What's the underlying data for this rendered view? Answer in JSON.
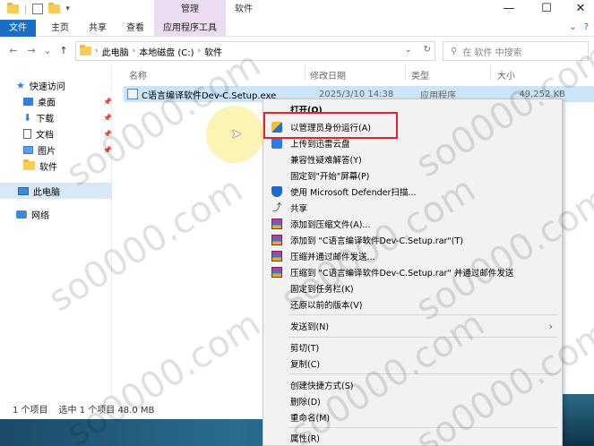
{
  "titlebar": {
    "manage_tab": "管理",
    "title": "软件",
    "minimize": "—",
    "maximize": "☐",
    "close": "✕"
  },
  "ribbon": {
    "tabs": [
      "文件",
      "主页",
      "共享",
      "查看",
      "应用程序工具"
    ],
    "collapse": "⌄",
    "help": "?"
  },
  "nav": {
    "back": "←",
    "forward": "→",
    "recent": "⌄",
    "up": "↑"
  },
  "address": {
    "crumbs": [
      "此电脑",
      "本地磁盘 (C:)",
      "软件"
    ],
    "separator": "›",
    "dropdown": "⌄",
    "refresh": "↻"
  },
  "search": {
    "placeholder": "在 软件 中搜索"
  },
  "sidebar": {
    "items": [
      {
        "label": "快速访问",
        "icon": "star-icon"
      },
      {
        "label": "桌面",
        "icon": "desktop-icon"
      },
      {
        "label": "下载",
        "icon": "download-icon"
      },
      {
        "label": "文档",
        "icon": "document-icon"
      },
      {
        "label": "图片",
        "icon": "picture-icon"
      },
      {
        "label": "软件",
        "icon": "folder-icon"
      },
      {
        "label": "此电脑",
        "icon": "computer-icon"
      },
      {
        "label": "网络",
        "icon": "network-icon"
      }
    ]
  },
  "columns": {
    "name": "名称",
    "date": "修改日期",
    "type": "类型",
    "size": "大小"
  },
  "file": {
    "name": "C语言编译软件Dev-C.Setup.exe",
    "date": "2025/3/10 14:38",
    "type": "应用程序",
    "size": "49,252 KB"
  },
  "status": {
    "count": "1 个项目",
    "selected": "选中 1 个项目  48.0 MB"
  },
  "context_menu": {
    "items": [
      {
        "label": "打开(O)",
        "icon": ""
      },
      {
        "label": "以管理员身份运行(A)",
        "icon": "uac-shield-icon"
      },
      {
        "label": "上传到迅雷云盘",
        "icon": "xunlei-icon"
      },
      {
        "label": "兼容性疑难解答(Y)",
        "icon": ""
      },
      {
        "label": "固定到\"开始\"屏幕(P)",
        "icon": ""
      },
      {
        "label": "使用 Microsoft Defender扫描...",
        "icon": "defender-icon"
      },
      {
        "label": "共享",
        "icon": "share-icon"
      },
      {
        "label": "添加到压缩文件(A)...",
        "icon": "winrar-icon"
      },
      {
        "label": "添加到 \"C语言编译软件Dev-C.Setup.rar\"(T)",
        "icon": "winrar-icon"
      },
      {
        "label": "压缩并通过邮件发送...",
        "icon": "winrar-icon"
      },
      {
        "label": "压缩到 \"C语言编译软件Dev-C.Setup.rar\" 并通过邮件发送",
        "icon": "winrar-icon"
      },
      {
        "label": "固定到任务栏(K)",
        "icon": ""
      },
      {
        "label": "还原以前的版本(V)",
        "icon": ""
      },
      {
        "label": "发送到(N)",
        "icon": ""
      },
      {
        "label": "剪切(T)",
        "icon": ""
      },
      {
        "label": "复制(C)",
        "icon": ""
      },
      {
        "label": "创建快捷方式(S)",
        "icon": ""
      },
      {
        "label": "删除(D)",
        "icon": ""
      },
      {
        "label": "重命名(M)",
        "icon": ""
      },
      {
        "label": "属性(R)",
        "icon": ""
      }
    ],
    "submenu_arrow": "›"
  },
  "watermark": "so0000.com",
  "colors": {
    "file_tab": "#1a6fc4",
    "manage_tab": "#ecdcf2",
    "selection": "#cce4f7",
    "highlight_box": "#e3242b"
  }
}
